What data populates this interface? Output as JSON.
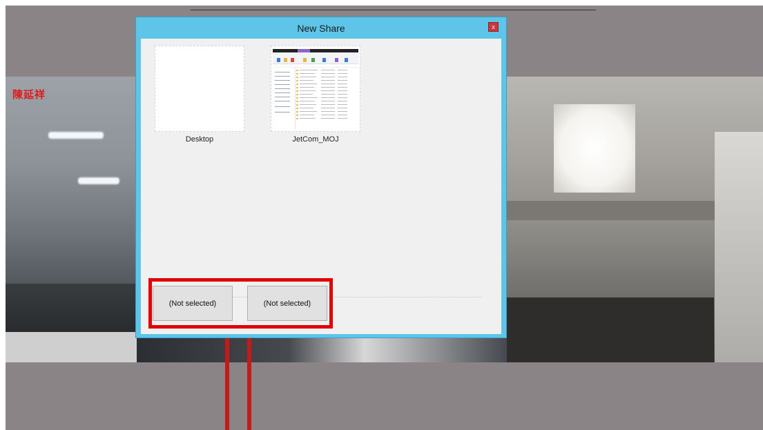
{
  "dialog": {
    "title": "New Share",
    "close_label": "x",
    "sources": [
      {
        "label": "Desktop"
      },
      {
        "label": "JetCom_MOJ"
      }
    ],
    "buttons": [
      "(Not selected)",
      "(Not selected)"
    ]
  },
  "video": {
    "caller_name": "陳延祥"
  },
  "colors": {
    "dialog_frame": "#5ec5e8",
    "dialog_body": "#f0f0f0",
    "close_button": "#c9363c",
    "highlight": "#e00000",
    "caller_name": "#e0191b",
    "backdrop": "#8a8487"
  },
  "icons": [
    "close-icon"
  ]
}
